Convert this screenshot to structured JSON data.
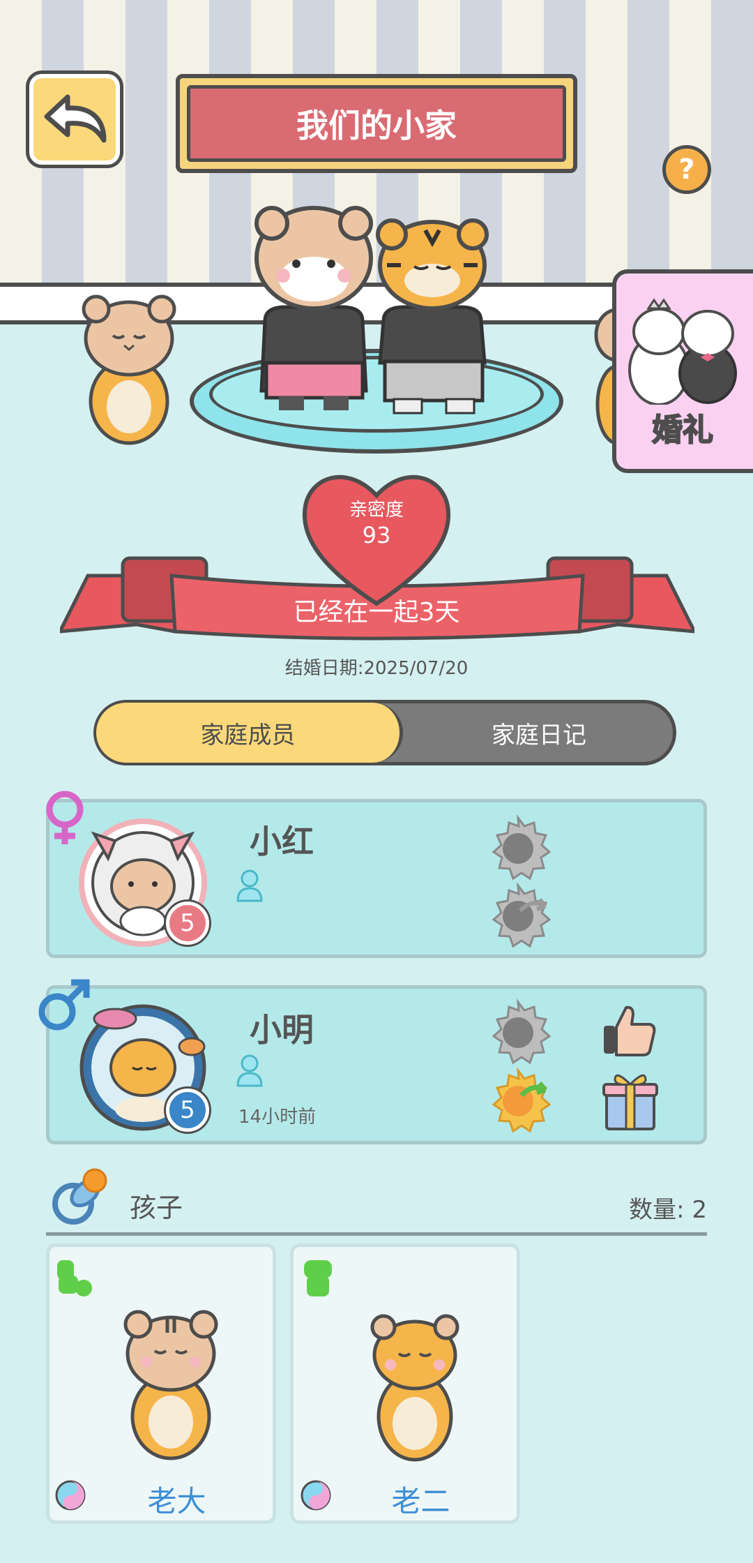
{
  "header": {
    "title": "我们的小家",
    "help_symbol": "?"
  },
  "wedding": {
    "label": "婚礼"
  },
  "intimacy": {
    "label": "亲密度",
    "value": "93"
  },
  "together": {
    "text": "已经在一起3天"
  },
  "marriage_date": {
    "text": "结婚日期:2025/07/20"
  },
  "tabs": [
    {
      "label": "家庭成员",
      "active": true
    },
    {
      "label": "家庭日记",
      "active": false
    }
  ],
  "members": [
    {
      "name": "小红",
      "gender": "female",
      "level": "5",
      "last_seen": ""
    },
    {
      "name": "小明",
      "gender": "male",
      "level": "5",
      "last_seen": "14小时前"
    }
  ],
  "children": {
    "title": "孩子",
    "count": "数量: 2",
    "items": [
      {
        "name": "老大"
      },
      {
        "name": "老二"
      }
    ]
  },
  "colors": {
    "accent_yellow": "#fbd97a",
    "title_red": "#d96b72",
    "heart_red": "#e8585f",
    "card_bg": "#b4e9ea",
    "tab_inactive": "#7b7b7b",
    "kid_name_blue": "#3d8fd6"
  }
}
